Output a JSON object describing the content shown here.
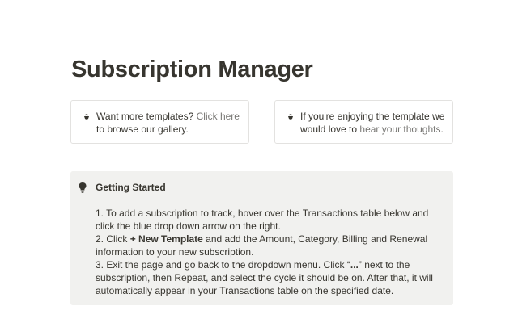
{
  "page": {
    "title": "Subscription Manager"
  },
  "callouts": [
    {
      "icon": "bowl-icon",
      "text_before": "Want more templates? ",
      "link": "Click here",
      "text_after": " to browse our gallery."
    },
    {
      "icon": "bowl-icon",
      "text_before": "If you're enjoying the template we would love to ",
      "link": "hear your thoughts",
      "text_after": "."
    }
  ],
  "getting_started": {
    "icon": "lightbulb-icon",
    "heading": "Getting Started",
    "step1": "1. To add a subscription to track, hover over the Transactions table below and click the blue drop down arrow on the right.",
    "step2_before": "2. Click ",
    "step2_bold": "+ New Template",
    "step2_after": " and add the Amount, Category, Billing and Renewal information to your new subscription.",
    "step3_before": "3. Exit the page and go back to the dropdown menu. Click “",
    "step3_bold": "...",
    "step3_after": "” next to the subscription, then Repeat, and select the cycle it should be on. After that, it will automatically appear in your Transactions table on the specified date."
  },
  "colors": {
    "text": "#37352f",
    "link": "#787774",
    "callout_bg": "#f1f1ef",
    "border": "#e3e2e0"
  }
}
